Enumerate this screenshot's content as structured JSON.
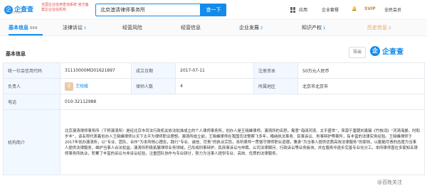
{
  "header": {
    "logo_char": "企",
    "logo_text": "企查查",
    "logo_sub": "Qcc.com",
    "slogan": "全国企业信用查询系统 官方备案企业征信机构",
    "search_value": "北京澳清律师事务所",
    "search_button": "查一下",
    "nav_app": "应用",
    "nav_ent": "企业套餐",
    "nav_svip": "SVIP",
    "nav_user": "全民会员"
  },
  "tabs": [
    {
      "label": "基本信息",
      "count": "669"
    },
    {
      "label": "法律诉讼",
      "count": "1"
    },
    {
      "label": "经营风险",
      "count": ""
    },
    {
      "label": "经营信息",
      "count": ""
    },
    {
      "label": "企业发展",
      "count": "2"
    },
    {
      "label": "知识产权",
      "count": "1"
    },
    {
      "label": "历史信息",
      "count": "2"
    }
  ],
  "section": {
    "title": "基本信息",
    "export_label": "导出",
    "brand": "企查查"
  },
  "table": {
    "credit_code_label": "统一社会信用代码",
    "credit_code": "31110000MD01621897",
    "established_label": "成立日期",
    "established": "2017-07-11",
    "registered_capital_label": "注册资本",
    "registered_capital": "50万元人民币",
    "principal_label": "负责人",
    "principal_avatar": "王",
    "principal": "王晓峰",
    "lawyers_label": "律师人数",
    "lawyers": "4",
    "region_label": "所属地区",
    "region": "北京市北京市",
    "phone_label": "电话",
    "phone": "010-32112988",
    "profile_label": "机构简介",
    "profile": "北京澳清律师事务所（下称澳清所）是经北京市司法行政机关依法批准成立的个人律师事务所，创办人是王晓峰律师。澳清所的名称，寓意“海阔河清、太平盛世”，来源于唐朝刘禹锡《竹枝词》“河清海晏，时和岁丰”，该名称代表着创办人王晓峰律师以天下太平为律师职业理想。澳清所成立前，王晓峰律师在我国司法警察飞多年，掩纳执法事务、民事诉讼、刑事辩护等案件，有丰富的法律实务经验。王晓峰律师于2017年创办澳清所，以“专业、团队、合作”为本所核心理念，践行“专业、诚信、尽责”的执业宗旨，本所律师一贯恪守律师职业道德，秉承“为当事人提供优质高效法律服务”的原则，以勤勉尽责的态度为当事人提供法律服务，维护当事人合法权益。澳清所积极拓展律师业务领域，已形成刑事辩护、民商事诉讼与仲裁、公司法律顾问、行政诉讼等业务板块，并在服务中逐步完善专业化分工。本所律师曾在多家知名律师事务所执业，积累了丰富的诉讼与非诉讼经验，注重团队协作与专业研讨，努力为当事人提供专业、高效、优质的法律服务。"
  },
  "watermark": "@百姓关注"
}
